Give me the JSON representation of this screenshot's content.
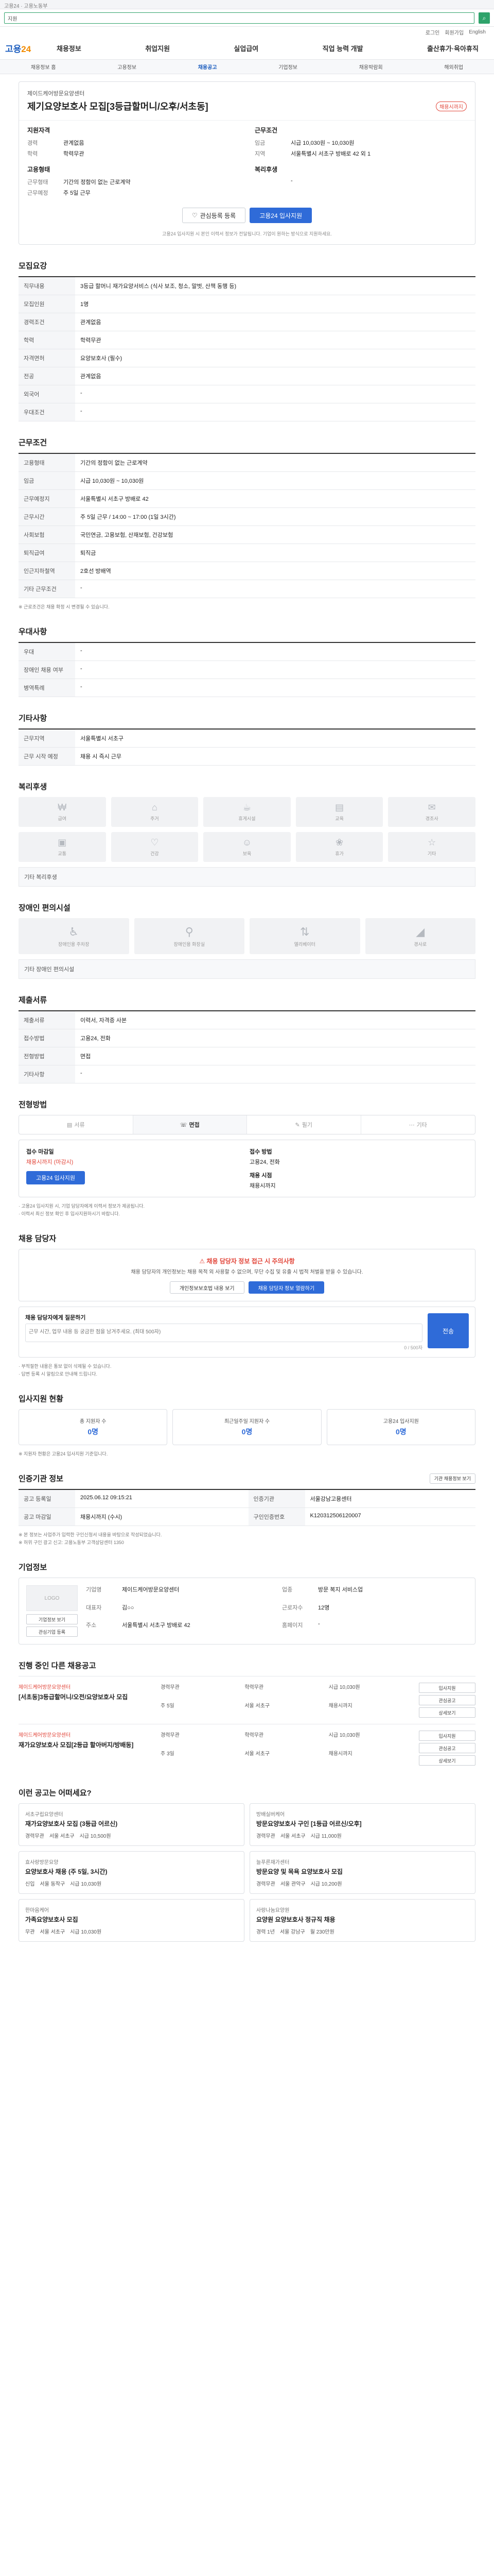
{
  "topbar": {
    "text": "고용24 · 고용노동부"
  },
  "search": {
    "value": "지원"
  },
  "utility": [
    "로그인",
    "회원가입",
    "English"
  ],
  "logo": {
    "main": "고용",
    "accent": "24"
  },
  "gnb": [
    "채용정보",
    "취업지원",
    "실업급여",
    "직업 능력 개발",
    "출산휴가·육아휴직"
  ],
  "subnav": {
    "items": [
      "채용정보 홈",
      "고용정보",
      "채용공고",
      "기업정보",
      "채용박람회",
      "해외취업"
    ],
    "active_index": 2
  },
  "job": {
    "company": "제이드케어방문요양센터",
    "title": "제기요양보호사 모집[3등급할머니/오후/서초동]",
    "dday": "채용시까지",
    "left_title": "지원자격",
    "left": [
      {
        "k": "경력",
        "v": "관계없음"
      },
      {
        "k": "학력",
        "v": "학력무관"
      }
    ],
    "left_title2": "고용형태",
    "left2": [
      {
        "k": "근무형태",
        "v": "기간의 정함이 없는 근로계약"
      },
      {
        "k": "근무예정",
        "v": "주 5일 근무"
      }
    ],
    "right_title": "근무조건",
    "right": [
      {
        "k": "임금",
        "v": "시급 10,030원 ~ 10,030원"
      },
      {
        "k": "지역",
        "v": "서울특별시 서초구 방배로 42 외 1"
      }
    ],
    "right_title2": "복리후생",
    "right2": [
      {
        "k": "",
        "v": "-"
      }
    ],
    "btn_scrap": "관심등록 등록",
    "btn_apply": "고용24 입사지원",
    "notice": "고용24 입사지원 시 본인 이력서 정보가 전달됩니다. 기업이 원하는 방식으로 지원하세요."
  },
  "sections": {
    "recruit": "모집요강",
    "work": "근무조건",
    "preference": "우대사항",
    "other": "기타사항",
    "welfare": "복리후생",
    "facility": "장애인 편의시설",
    "docs": "제출서류",
    "method": "전형방법",
    "contact": "채용 담당자",
    "status": "입사지원 현황",
    "posting": "인증기관 정보",
    "company": "기업정보",
    "others": "진행 중인 다른 채용공고",
    "recommend": "이런 공고는 어떠세요?"
  },
  "recruit": [
    {
      "k": "직무내용",
      "v": "3등급 할머니 재가요양서비스 (식사 보조, 청소, 말벗, 산책 동행 등)"
    },
    {
      "k": "모집인원",
      "v": "1명"
    },
    {
      "k": "경력조건",
      "v": "관계없음"
    },
    {
      "k": "학력",
      "v": "학력무관"
    },
    {
      "k": "자격면허",
      "v": "요양보호사 (필수)"
    },
    {
      "k": "전공",
      "v": "관계없음"
    },
    {
      "k": "외국어",
      "v": "-"
    },
    {
      "k": "우대조건",
      "v": "-"
    }
  ],
  "work": [
    {
      "k": "고용형태",
      "v": "기간의 정함이 없는 근로계약"
    },
    {
      "k": "임금",
      "v": "시급 10,030원 ~ 10,030원"
    },
    {
      "k": "근무예정지",
      "v": "서울특별시 서초구 방배로 42"
    },
    {
      "k": "근무시간",
      "v": "주 5일 근무 / 14:00 ~ 17:00 (1일 3시간)"
    },
    {
      "k": "사회보험",
      "v": "국민연금, 고용보험, 산재보험, 건강보험"
    },
    {
      "k": "퇴직급여",
      "v": "퇴직금"
    },
    {
      "k": "인근지하철역",
      "v": "2호선 방배역"
    },
    {
      "k": "기타 근무조건",
      "v": "-"
    }
  ],
  "work_notes": "※ 근로조건은 채용 확정 시 변경될 수 있습니다.",
  "preference": [
    {
      "k": "우대",
      "v": "-"
    },
    {
      "k": "장애인 채용 여부",
      "v": "-"
    },
    {
      "k": "병역특례",
      "v": "-"
    }
  ],
  "other_info": [
    {
      "k": "근무지역",
      "v": "서울특별시 서초구"
    },
    {
      "k": "근무 시작 예정",
      "v": "채용 시 즉시 근무"
    }
  ],
  "welfare_items": [
    {
      "icon": "money-icon",
      "label": "급여"
    },
    {
      "icon": "house-icon",
      "label": "주거"
    },
    {
      "icon": "coffee-icon",
      "label": "휴게시설"
    },
    {
      "icon": "book-icon",
      "label": "교육"
    },
    {
      "icon": "gift-icon",
      "label": "경조사"
    },
    {
      "icon": "bus-icon",
      "label": "교통"
    },
    {
      "icon": "heart-icon",
      "label": "건강"
    },
    {
      "icon": "child-icon",
      "label": "보육"
    },
    {
      "icon": "leaf-icon",
      "label": "휴가"
    },
    {
      "icon": "star-icon",
      "label": "기타"
    }
  ],
  "welfare_extra": "기타 복리후생",
  "facility_items": [
    {
      "icon": "wheelchair-icon",
      "label": "장애인용 주차장"
    },
    {
      "icon": "toilet-icon",
      "label": "장애인용 화장실"
    },
    {
      "icon": "elevator-icon",
      "label": "엘리베이터"
    },
    {
      "icon": "ramp-icon",
      "label": "경사로"
    }
  ],
  "facility_extra": "기타 장애인 편의시설",
  "docs": [
    {
      "k": "제출서류",
      "v": "이력서, 자격증 사본"
    },
    {
      "k": "접수방법",
      "v": "고용24, 전화"
    },
    {
      "k": "전형방법",
      "v": "면접"
    },
    {
      "k": "기타사항",
      "v": "-"
    }
  ],
  "method_tabs": [
    {
      "icon": "doc-icon",
      "label": "서류"
    },
    {
      "icon": "talk-icon",
      "label": "면접"
    },
    {
      "icon": "pencil-icon",
      "label": "필기"
    },
    {
      "icon": "dots-icon",
      "label": "기타"
    }
  ],
  "method_active": 1,
  "apply": {
    "deadline_label": "접수 마감일",
    "deadline": "채용시까지 (마감시)",
    "method_label": "접수 방법",
    "method": "고용24, 전화",
    "btn": "고용24 입사지원",
    "result_label": "채용 시점",
    "result": "채용시까지"
  },
  "apply_notes": [
    "· 고용24 입사지원 시, 기업 담당자에게 이력서 정보가 제공됩니다.",
    "· 이력서 최신 정보 확인 후 입사지원하시기 바랍니다."
  ],
  "contact": {
    "warn": "채용 담당자 정보 접근 시 주의사항",
    "text": "채용 담당자의 개인정보는 채용 목적 외 사용할 수 없으며, 무단 수집 및 유출 시 법적 처벌을 받을 수 있습니다.",
    "btn1": "개인정보보호법 내용 보기",
    "btn2": "채용 담당자 정보 열람하기"
  },
  "inquiry": {
    "label": "채용 담당자에게 질문하기",
    "placeholder": "근무 시간, 업무 내용 등 궁금한 점을 남겨주세요. (최대 500자)",
    "count": "0 / 500자",
    "send": "전송"
  },
  "inquiry_notes": [
    "· 부적절한 내용은 통보 없이 삭제될 수 있습니다.",
    "· 답변 등록 시 알림으로 안내해 드립니다."
  ],
  "status": [
    {
      "label": "총 지원자 수",
      "value": "0명"
    },
    {
      "label": "최근일주일 지원자 수",
      "value": "0명"
    },
    {
      "label": "고용24 입사지원",
      "value": "0명"
    }
  ],
  "status_note": "※ 지원자 현황은 고용24 입사지원 기준입니다.",
  "posting": {
    "btn": "기관 채용정보 보기",
    "rows": [
      {
        "k1": "공고 등록일",
        "v1": "2025.06.12 09:15:21",
        "k2": "인증기관",
        "v2": "서울강남고용센터"
      },
      {
        "k1": "공고 마감일",
        "v1": "채용시까지 (수시)",
        "k2": "구인인증번호",
        "v2": "K120312506120007"
      }
    ],
    "notes": [
      "※ 본 정보는 사업주가 입력한 구인신청서 내용을 바탕으로 작성되었습니다.",
      "※ 허위 구인 광고 신고: 고용노동부 고객상담센터 1350"
    ]
  },
  "company": {
    "logo": "LOGO",
    "btn1": "기업정보 보기",
    "btn2": "관심기업 등록",
    "rows": [
      {
        "k": "기업명",
        "v": "제이드케어방문요양센터"
      },
      {
        "k": "업종",
        "v": "방문 복지 서비스업"
      },
      {
        "k": "대표자",
        "v": "김○○"
      },
      {
        "k": "근로자수",
        "v": "12명"
      },
      {
        "k": "주소",
        "v": "서울특별시 서초구 방배로 42"
      },
      {
        "k": "홈페이지",
        "v": "-"
      }
    ]
  },
  "others": [
    {
      "co": "제이드케어방문요양센터",
      "title": "[서초동]3등급할머니/오전/요양보호사 모집",
      "meta": [
        "경력무관",
        "학력무관",
        "시급 10,030원",
        "주 5일",
        "서울 서초구",
        "채용시까지"
      ],
      "btns": [
        "입사지원",
        "관심공고",
        "상세보기"
      ]
    },
    {
      "co": "제이드케어방문요양센터",
      "title": "재가요양보호사 모집[2등급 할아버지/방배동]",
      "meta": [
        "경력무관",
        "학력무관",
        "시급 10,030원",
        "주 3일",
        "서울 서초구",
        "채용시까지"
      ],
      "btns": [
        "입사지원",
        "관심공고",
        "상세보기"
      ]
    }
  ],
  "recommend": [
    {
      "co": "서초구립요양센터",
      "title": "재가요양보호사 모집 (3등급 어르신)",
      "meta": [
        "경력무관",
        "서울 서초구",
        "시급 10,500원"
      ]
    },
    {
      "co": "방배실버케어",
      "title": "방문요양보호사 구인 [1등급 어르신/오후]",
      "meta": [
        "경력무관",
        "서울 서초구",
        "시급 11,000원"
      ]
    },
    {
      "co": "효사랑방문요양",
      "title": "요양보호사 채용 (주 5일, 3시간)",
      "meta": [
        "신입",
        "서울 동작구",
        "시급 10,030원"
      ]
    },
    {
      "co": "늘푸른재가센터",
      "title": "방문요양 및 목욕 요양보호사 모집",
      "meta": [
        "경력무관",
        "서울 관악구",
        "시급 10,200원"
      ]
    },
    {
      "co": "한마음케어",
      "title": "가족요양보호사 모집",
      "meta": [
        "무관",
        "서울 서초구",
        "시급 10,030원"
      ]
    },
    {
      "co": "사랑나눔요양원",
      "title": "요양원 요양보호사 정규직 채용",
      "meta": [
        "경력 1년",
        "서울 강남구",
        "월 230만원"
      ]
    }
  ]
}
